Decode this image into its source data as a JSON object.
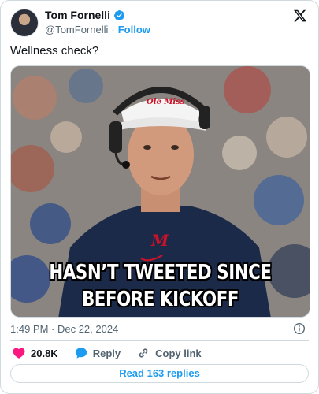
{
  "author": {
    "name": "Tom Fornelli",
    "handle": "@TomFornelli",
    "separator": "·",
    "follow_label": "Follow"
  },
  "tweet": {
    "text": "Wellness check?",
    "image_caption_line1": "HASN’T TWEETED SINCE",
    "image_caption_line2": "BEFORE KICKOFF",
    "cap_logo_text": "Ole Miss",
    "shirt_logo_text": "M",
    "timestamp": "1:49 PM · Dec 22, 2024"
  },
  "actions": {
    "likes": "20.8K",
    "reply_label": "Reply",
    "copy_link_label": "Copy link"
  },
  "read_replies_label": "Read 163 replies",
  "colors": {
    "accent": "#1d9bf0",
    "like": "#f91880",
    "text": "#0f1419",
    "secondary": "#536471",
    "border": "#cfd9de",
    "navy_shirt": "#1c2a4a",
    "red_logo": "#ce1126"
  },
  "icons": {
    "verified": "verified-badge-icon",
    "platform": "x-logo-icon",
    "info": "info-icon",
    "like": "heart-icon",
    "reply": "reply-bubble-icon",
    "copy": "link-icon"
  }
}
